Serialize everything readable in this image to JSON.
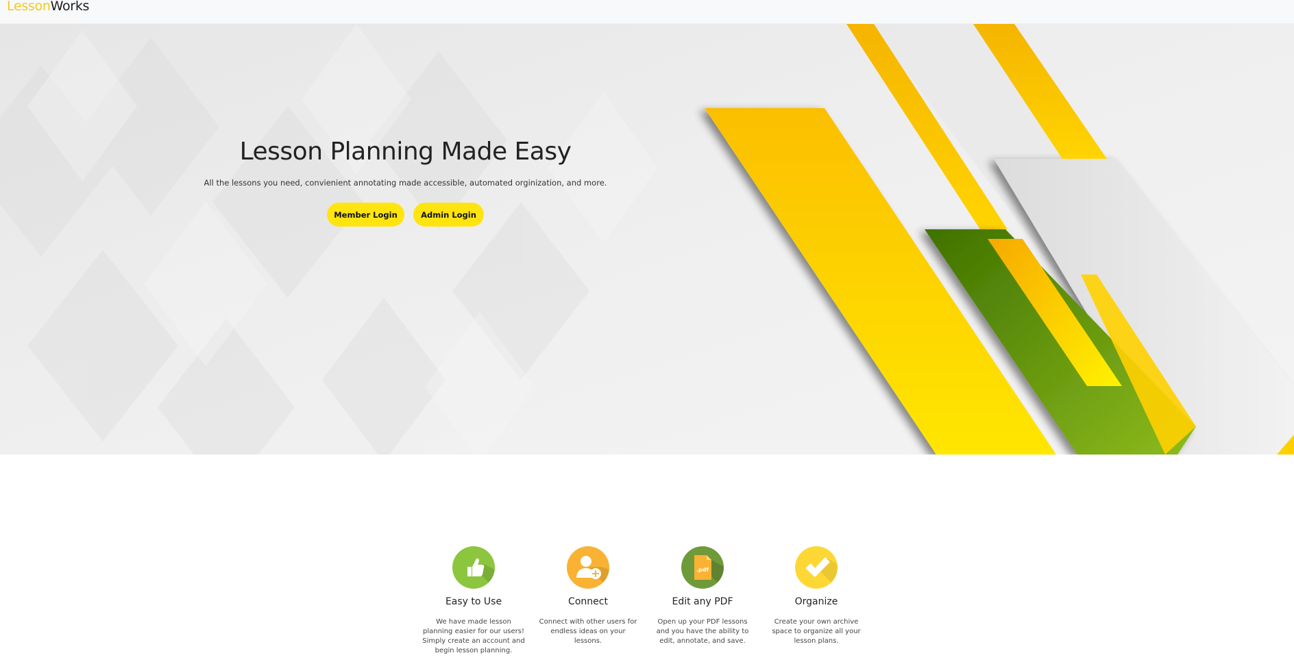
{
  "navbar": {
    "brand_part1": "Lesson",
    "brand_part2": "Works"
  },
  "hero": {
    "title": "Lesson Planning Made Easy",
    "subtitle": "All the lessons you need, convienient annotating made accessible, automated orginization, and more.",
    "member_login_label": "Member Login",
    "admin_login_label": "Admin Login"
  },
  "features": [
    {
      "icon": "thumbs-up-icon",
      "color": "#8cc63f",
      "title": "Easy to Use",
      "description": "We have made lesson planning easier for our users! Simply create an account and begin lesson planning."
    },
    {
      "icon": "add-user-icon",
      "color": "#f9b233",
      "title": "Connect",
      "description": "Connect with other users for endless ideas on your lessons."
    },
    {
      "icon": "pdf-file-icon",
      "color": "#6f9a3a",
      "title": "Edit any PDF",
      "description": "Open up your PDF lessons and you have the ability to edit, annotate, and save."
    },
    {
      "icon": "checkmark-icon",
      "color": "#fdd835",
      "title": "Organize",
      "description": "Create your own archive space to organize all your lesson plans."
    }
  ],
  "colors": {
    "accent_yellow": "#ffe40f",
    "brand_yellow": "#f3c81a",
    "stripe_green": "#5a9a1a"
  }
}
